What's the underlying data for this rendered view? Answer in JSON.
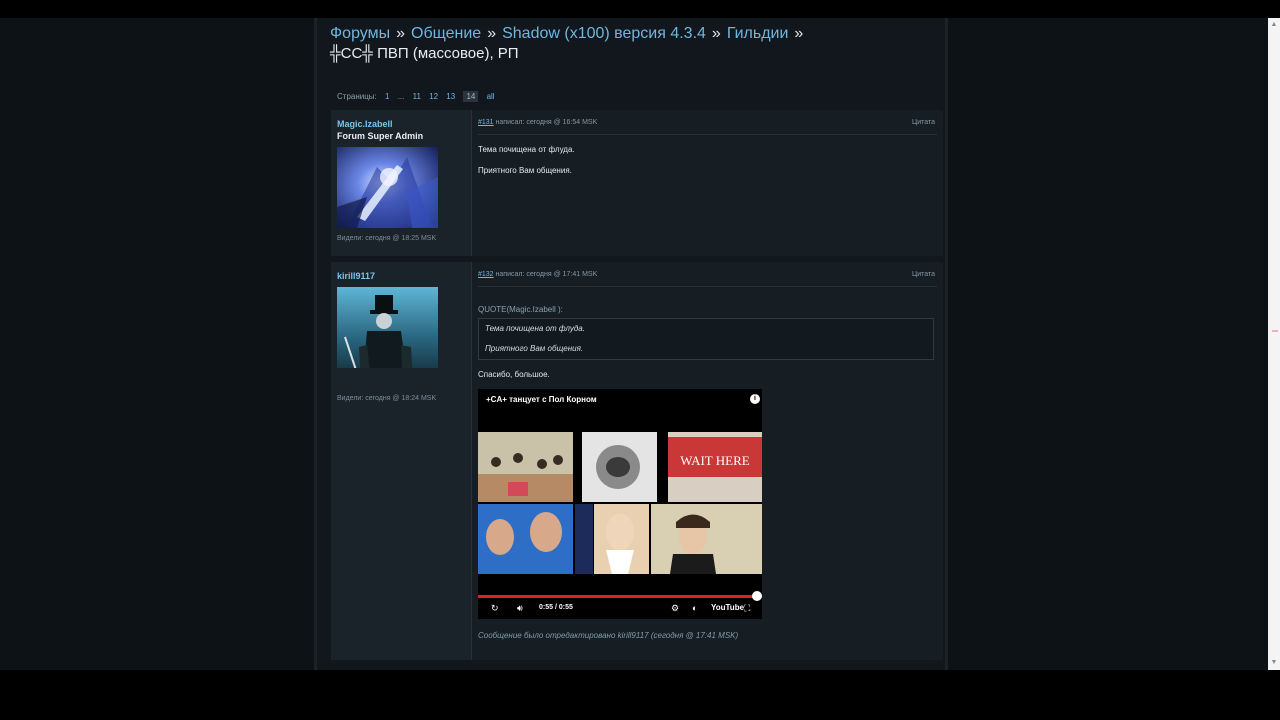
{
  "breadcrumb": {
    "items": [
      "Форумы",
      "Общение",
      "Shadow (x100) версия 4.3.4",
      "Гильдии"
    ],
    "separator": "»"
  },
  "topic": {
    "title": "╬CC╬ ПВП (массовое), РП"
  },
  "pagination": {
    "label": "Страницы:",
    "pages": [
      "1",
      "...",
      "11",
      "12",
      "13",
      "14",
      "all"
    ],
    "current": "14"
  },
  "posts": [
    {
      "author": "Magic.Izabell",
      "rank": "Forum Super Admin",
      "seen": "Видели: сегодня @ 18:25 MSK",
      "number": "#131",
      "meta": "написал: сегодня @ 16:54 MSK",
      "quote_label": "Цитата",
      "lines": [
        "Тема почищена от флуда.",
        "Приятного Вам общения."
      ]
    },
    {
      "author": "kirill9117",
      "seen": "Видели: сегодня @ 18:24 MSK",
      "number": "#132",
      "meta": "написал: сегодня @ 17:41 MSK",
      "quote_label": "Цитата",
      "quote_header": "QUOTE(Magic.Izabell ):",
      "quote_lines": [
        "Тема почищена от флуда.",
        "Приятного Вам общения."
      ],
      "reply": "Спасибо, большое.",
      "edited": "Сообщение было отредактировано kirill9117 (сегодня @ 17:41 MSK)"
    }
  ],
  "video": {
    "title": "+CA+ танцует с Пол Корном",
    "time": "0:55 / 0:55",
    "poster_text": "WAIT HERE",
    "brand": "YouTube",
    "progress": 0.98,
    "icons": [
      "info-icon",
      "replay-icon",
      "volume-icon",
      "settings-icon",
      "annotations-icon",
      "fullscreen-icon"
    ]
  },
  "colors": {
    "link": "#6fb6e0",
    "background": "#11171c",
    "post_bg": "#161e24",
    "progress": "#e02020"
  }
}
